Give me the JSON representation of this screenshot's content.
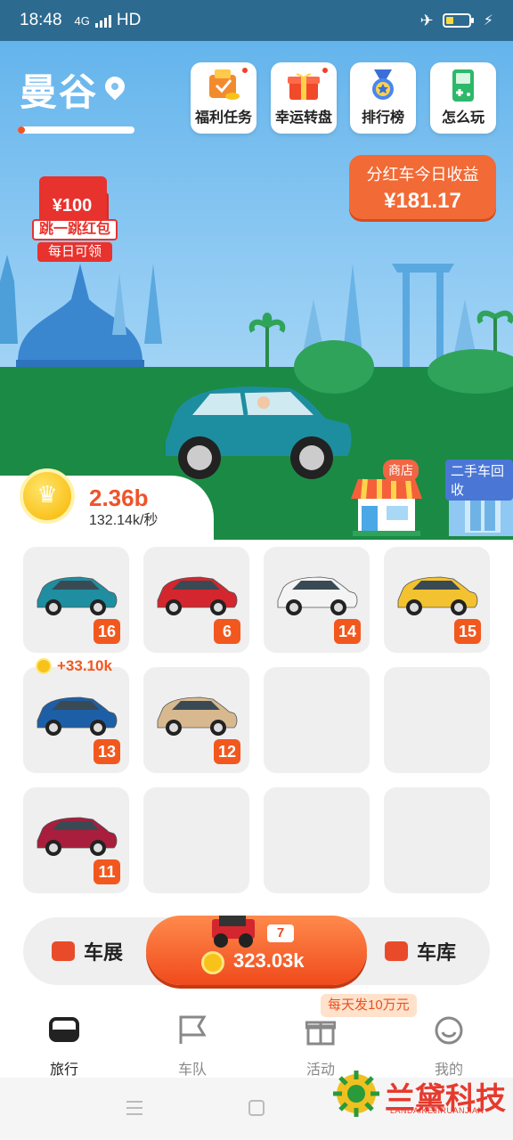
{
  "status": {
    "time": "18:48",
    "network": "4G",
    "hd": "HD"
  },
  "header": {
    "city": "曼谷",
    "progress": 0.06,
    "buttons": [
      {
        "label": "福利任务",
        "icon": "gift-task-icon"
      },
      {
        "label": "幸运转盘",
        "icon": "gift-box-icon"
      },
      {
        "label": "排行榜",
        "icon": "medal-icon"
      },
      {
        "label": "怎么玩",
        "icon": "game-console-icon"
      }
    ],
    "earnings": {
      "title": "分红车今日收益",
      "amount": "¥181.17"
    },
    "redpacket": {
      "amount": "¥100",
      "line1": "跳一跳红包",
      "line2": "每日可领"
    }
  },
  "wallet": {
    "coins": "2.36b",
    "rate": "132.14k/秒"
  },
  "shop": {
    "store_label": "商店",
    "recycle_label": "二手车回收"
  },
  "slots": [
    {
      "level": "16",
      "color": "#1f8ea0"
    },
    {
      "level": "6",
      "color": "#d3262e"
    },
    {
      "level": "14",
      "color": "#f4f4f4"
    },
    {
      "level": "15",
      "color": "#f2c230"
    },
    {
      "level": "13",
      "color": "#1d5fa6"
    },
    {
      "level": "12",
      "color": "#d8b98f"
    },
    {
      "level": "",
      "color": ""
    },
    {
      "level": "",
      "color": ""
    },
    {
      "level": "11",
      "color": "#a81e3c"
    },
    {
      "level": "",
      "color": ""
    },
    {
      "level": "",
      "color": ""
    },
    {
      "level": "",
      "color": ""
    }
  ],
  "bonus": "+33.10k",
  "actions": {
    "show_label": "车展",
    "garage_label": "车库",
    "buy_level": "7",
    "buy_price": "323.03k"
  },
  "notice": "每天发10万元",
  "nav": [
    {
      "label": "旅行",
      "icon": "car-front-icon"
    },
    {
      "label": "车队",
      "icon": "flag-icon"
    },
    {
      "label": "活动",
      "icon": "gift-icon"
    },
    {
      "label": "我的",
      "icon": "smile-icon"
    }
  ],
  "watermark": {
    "title": "兰黛科技",
    "subtitle": "LANDAIKEJIRUANJIAN"
  },
  "colors": {
    "accent": "#f2581e",
    "sky": "#64b4ec",
    "grass": "#1b8a45"
  }
}
